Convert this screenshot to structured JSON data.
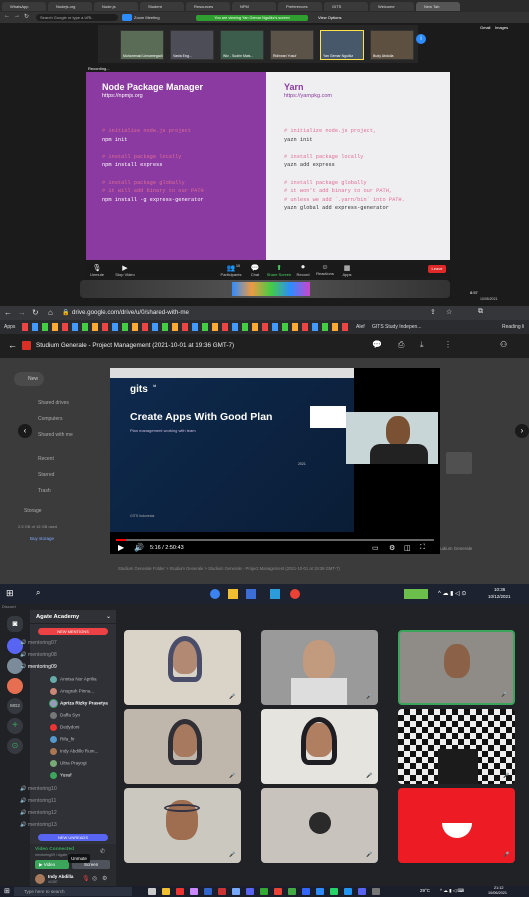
{
  "zoom_window": {
    "browser_tabs": [
      "WhatsApp",
      "Nodejs.org",
      "Node.js",
      "Student",
      "Resources",
      "NPM",
      "Preferences",
      "GITS",
      "Welcome",
      "New Tab"
    ],
    "address": "Search Google or type a URL",
    "bookmark": "Zoom Meeting",
    "banner": "You are viewing Yan Gemar Ngulikz's screen",
    "view_options": "View Options",
    "participants": [
      "Muhammad Linnamegadi",
      "Vania Eng...",
      "Wiz - Sudrin Mais...",
      "Ridhwan Yusuf",
      "Yan Gemar Ngulikz",
      "Budy Abdulla"
    ],
    "recording": "Recording...",
    "slide": {
      "left_title": "Node Package Manager",
      "left_url": "https://npmjs.org",
      "right_title": "Yarn",
      "right_url": "https://yarnpkg.com",
      "left_lines": [
        {
          "t": "# initialize node.js project",
          "c": true
        },
        {
          "t": "npm init",
          "c": false
        },
        {
          "t": "",
          "c": false
        },
        {
          "t": "# install package locally",
          "c": true
        },
        {
          "t": "npm install express",
          "c": false
        },
        {
          "t": "",
          "c": false
        },
        {
          "t": "# install package globally",
          "c": true
        },
        {
          "t": "# it will add binary to our PATH",
          "c": true
        },
        {
          "t": "npm install -g express-generator",
          "c": false
        }
      ],
      "right_lines": [
        {
          "t": "# initialize node.js project,",
          "c": true
        },
        {
          "t": "yazn init",
          "c": false
        },
        {
          "t": "",
          "c": false
        },
        {
          "t": "# install package locally",
          "c": true
        },
        {
          "t": "yazn add express",
          "c": false
        },
        {
          "t": "",
          "c": false
        },
        {
          "t": "# install package globally",
          "c": true
        },
        {
          "t": "# it won't add binary to our PATH,",
          "c": true
        },
        {
          "t": "# unless we add `.yarn/bin` into PATH.",
          "c": true
        },
        {
          "t": "yazn global add express-generator",
          "c": false
        }
      ]
    },
    "controls": [
      "Unmute",
      "Stop Video",
      "Participants",
      "Chat",
      "Share Screen",
      "Record",
      "Reactions",
      "Apps"
    ],
    "participant_count": "10",
    "leave": "Leave",
    "clock": "8:57",
    "date": "10/05/2021",
    "side_links": [
      "Gmail",
      "Images"
    ]
  },
  "drive_window": {
    "address": "drive.google.com/drive/u/0/shared-with-me",
    "bookmarks_left": "Apps",
    "bookmark_alef": "Alef",
    "bookmark_gits": "GITS Study Indepen...",
    "bookmark_reading": "Reading li",
    "file_title": "Studium Generale - Project Management (2021-10-01 at 19:36 GMT-7)",
    "nav_items": [
      "New",
      "Shared drives",
      "Computers",
      "Shared with me",
      "Recent",
      "Starred",
      "Trash",
      "Storage"
    ],
    "storage_text": "2.5 GB of 15 GB used",
    "buy_storage": "Buy storage",
    "video": {
      "logo": "gits",
      "logo_sup": "id",
      "title": "Create Apps With Good Plan",
      "subtitle": "Plan management working with team",
      "year": "2021",
      "footer": "GITS Indonesia",
      "time": "5:16 / 2:50:43"
    },
    "breadcrumb": "Studium Generale Folder  >  Studium Generale  >  Studium Generale - Project Management (2021-10-01 at 19:36 GMT-7)",
    "side_label": "Studium Generale",
    "taskbar_clock": "10:36",
    "taskbar_date": "10/12/2021"
  },
  "discord_window": {
    "server": "Agate Academy",
    "app_label": "Discord",
    "new_mentions": "NEW MENTIONS",
    "channels_top": [
      "mentoring07",
      "mentoring08",
      "mentoring09"
    ],
    "members": [
      "Annisa Nur Aprilia",
      "Anugrah Pinna...",
      "Apriza Rizky Prasetya",
      "Daffa Syn",
      "Dedydoni",
      "Rifa_fir",
      "Indy Abdillo Rum...",
      "Ultra Prayogi",
      "Yusuf"
    ],
    "channels_bottom": [
      "mentoring10",
      "mentoring11",
      "mentoring12",
      "mentoring13"
    ],
    "new_unreads": "NEW UNREADS",
    "voice_status": "Video Connected",
    "voice_sub": "mentoring09 / Agate Acad...",
    "video_btn": "Video",
    "screen_btn": "Screen",
    "tooltip": "Unmute",
    "user_name": "Indy Abdilla",
    "user_tag": "#0387",
    "server_badge": "MG2",
    "search": "Type here to search",
    "weather": "29°C",
    "clock": "21:12",
    "date": "10/06/2021"
  },
  "colors": {
    "slide_purple": "#8a3aa0",
    "slide_grey": "#efeff1",
    "leave_red": "#e02828",
    "discord_green": "#3ba55c",
    "yt_red": "#ff0000",
    "badge_red": "#ed4245"
  }
}
